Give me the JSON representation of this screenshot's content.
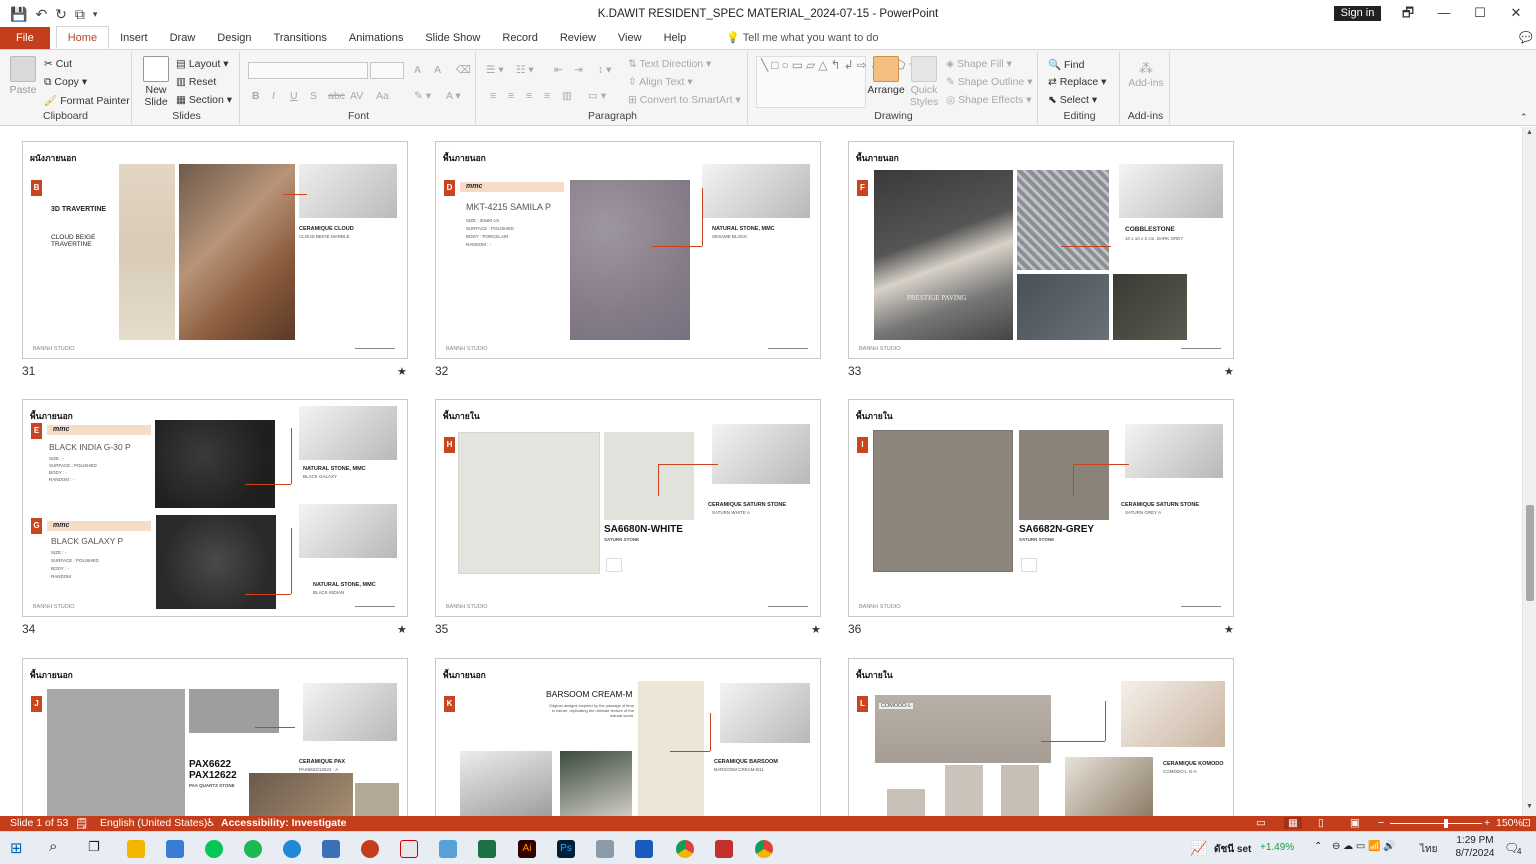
{
  "window": {
    "title": "K.DAWIT RESIDENT_SPEC MATERIAL_2024-07-15  -  PowerPoint",
    "signin": "Sign in",
    "restore": "🗗",
    "minimize": "—",
    "maximize": "☐",
    "close": "✕"
  },
  "qat": {
    "save": "💾",
    "undo": "↶",
    "redo": "↻",
    "present": "⧉",
    "more": "▾"
  },
  "tabs": [
    "File",
    "Home",
    "Insert",
    "Draw",
    "Design",
    "Transitions",
    "Animations",
    "Slide Show",
    "Record",
    "Review",
    "View",
    "Help"
  ],
  "tellme": "Tell me what you want to do",
  "ribbon": {
    "clipboard": {
      "paste": "Paste",
      "cut": "Cut",
      "copy": "Copy",
      "format_painter": "Format Painter",
      "label": "Clipboard"
    },
    "slides": {
      "new_slide": "New Slide",
      "layout": "Layout",
      "reset": "Reset",
      "section": "Section",
      "label": "Slides"
    },
    "font": {
      "bold": "B",
      "italic": "I",
      "underline": "U",
      "shadow": "S",
      "strike": "abc",
      "spacing": "AV",
      "case": "Aa",
      "grow": "A",
      "shrink": "A",
      "label": "Font"
    },
    "paragraph": {
      "text_direction": "Text Direction",
      "align_text": "Align Text",
      "smartart": "Convert to SmartArt",
      "label": "Paragraph"
    },
    "drawing": {
      "arrange": "Arrange",
      "quick_styles": "Quick Styles",
      "shape_fill": "Shape Fill",
      "shape_outline": "Shape Outline",
      "shape_effects": "Shape Effects",
      "label": "Drawing"
    },
    "editing": {
      "find": "Find",
      "replace": "Replace",
      "select": "Select",
      "label": "Editing"
    },
    "addins": {
      "addins": "Add-ins",
      "label": "Add-ins"
    }
  },
  "slides": [
    {
      "num": "31",
      "star": "★",
      "header": "ผนังภายนอก",
      "letter": "B",
      "title1": "3D TRAVERTINE",
      "title2": "CLOUD BEIGE TRAVERTINE",
      "caption": "CERAMIQUE CLOUD",
      "caption2": "CLOUD BEIGE MARBLE",
      "footer": "BANNH STUDIO"
    },
    {
      "num": "32",
      "star": "★",
      "header": "พื้นภายนอก",
      "letter": "D",
      "brand": "mmc",
      "code": "MKT-4215 SAMILA P",
      "spec": [
        "SIZE : 30x60 cm",
        "SURFACE : POLISHED",
        "BODY : PORCELAIN",
        "RANDOM : -"
      ],
      "caption": "NATURAL STONE, MMC",
      "caption2": "SESAME BLOCK",
      "footer": "BANNH STUDIO"
    },
    {
      "num": "33",
      "star": "★",
      "header": "พื้นภายนอก",
      "letter": "F",
      "prestige": "PRESTIGE PAVING",
      "caption": "COBBLESTONE",
      "caption2": "10 x 10 x 2 cm. DARK GREY",
      "footer": "BANNH STUDIO"
    },
    {
      "num": "34",
      "star": "★",
      "header": "พื้นภายนอก",
      "letter1": "E",
      "letter2": "G",
      "brand": "mmc",
      "code1": "BLACK INDIA G-30 P",
      "code2": "BLACK GALAXY P",
      "spec1": [
        "SIZE : -",
        "SURFACE : POLISHED",
        "BODY : -",
        "RANDOM : -"
      ],
      "spec2": [
        "SIZE : -",
        "SURFACE : POLISHED",
        "BODY : -",
        "RANDOM"
      ],
      "caption": "NATURAL STONE, MMC",
      "caption2a": "BLACK GALAXY",
      "caption2b": "BLACK INDIAN",
      "footer": "BANNH STUDIO"
    },
    {
      "num": "35",
      "star": "★",
      "header": "พื้นภายใน",
      "letter": "H",
      "code": "SA6680N-WHITE",
      "sub": "SATURN STONE",
      "caption": "CERAMIQUE SATURN STONE",
      "caption2": "SATURN WHITE A",
      "footer": "BANNH STUDIO"
    },
    {
      "num": "36",
      "star": "★",
      "header": "พื้นภายใน",
      "letter": "I",
      "code": "SA6682N-GREY",
      "sub": "SATURN STONE",
      "caption": "CERAMIQUE SATURN STONE",
      "caption2": "SATURN GREY A",
      "footer": "BANNH STUDIO"
    },
    {
      "header": "พื้นภายนอก",
      "letter": "J",
      "code1": "PAX6622",
      "code2": "PAX12622",
      "sub": "PAX QUARTZ STONE",
      "caption": "CERAMIQUE PAX",
      "caption2": "PAX6622/12622 · A"
    },
    {
      "header": "พื้นภายนอก",
      "letter": "K",
      "code": "BARSOOM CREAM-M",
      "desc": "Original designs inspired by the passage of time in nature, replicating the ultimate texture of the natural world.",
      "caption": "CERAMIQUE BARSOOM",
      "caption2": "BARSOOM CREAM-B11"
    },
    {
      "header": "พื้นภายใน",
      "letter": "L",
      "label": "COMODO-L",
      "caption": "CERAMIQUE KOMODO",
      "caption2": "COMODO-L G-A"
    }
  ],
  "status": {
    "slide": "Slide 1 of 53",
    "lang": "English (United States)",
    "access": "Accessibility: Investigate",
    "zoom": "150%"
  },
  "taskbar": {
    "stock": "ดัชนี set",
    "change": "+1.49%",
    "lang": "ไทย",
    "time": "1:29 PM",
    "date": "8/7/2024",
    "notif": "4"
  },
  "colors": {
    "accent": "#c43e1c",
    "slide_tag": "#c8451f"
  }
}
